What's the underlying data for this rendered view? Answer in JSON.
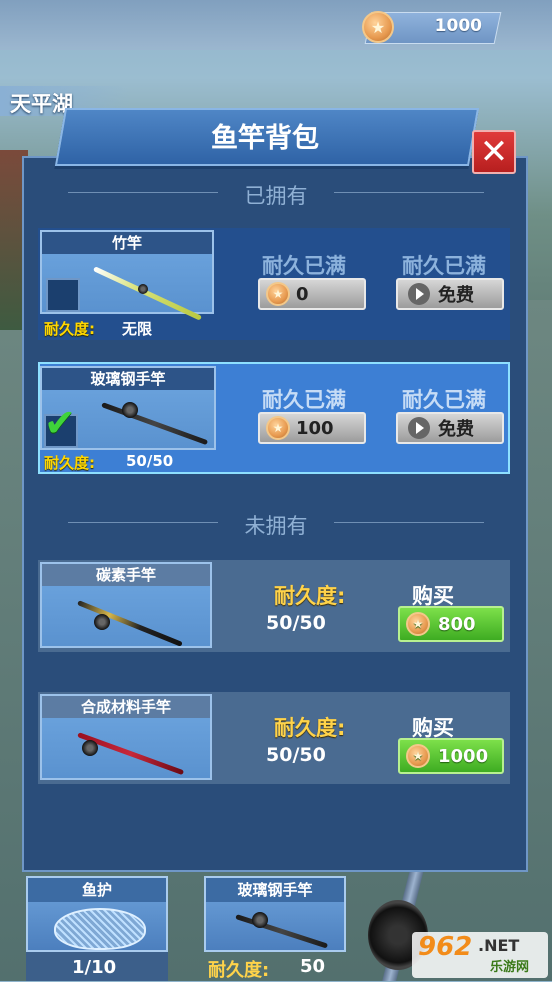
{
  "top_bar": {
    "coins": "1000"
  },
  "location": "天平湖",
  "panel": {
    "title": "鱼竿背包",
    "owned_heading": "已拥有",
    "unowned_heading": "未拥有"
  },
  "owned_rods": [
    {
      "name": "竹竿",
      "durability_label": "耐久度:",
      "durability_value": "无限",
      "repair_status": "耐久已满",
      "repair_coin_cost": "0",
      "free_status": "耐久已满",
      "free_label": "免费",
      "equipped": false
    },
    {
      "name": "玻璃钢手竿",
      "durability_label": "耐久度:",
      "durability_value": "50/50",
      "repair_status": "耐久已满",
      "repair_coin_cost": "100",
      "free_status": "耐久已满",
      "free_label": "免费",
      "equipped": true
    }
  ],
  "unowned_rods": [
    {
      "name": "碳素手竿",
      "durability_label": "耐久度:",
      "durability_value": "50/50",
      "buy_label": "购买",
      "price": "800"
    },
    {
      "name": "合成材料手竿",
      "durability_label": "耐久度:",
      "durability_value": "50/50",
      "buy_label": "购买",
      "price": "1000"
    }
  ],
  "bottom_slots": [
    {
      "title": "鱼护",
      "footer": "1/10"
    },
    {
      "title": "玻璃钢手竿",
      "footer_label": "耐久度:",
      "footer_value": "50"
    }
  ],
  "watermark": {
    "number": "962",
    "suffix": ".NET",
    "site": "乐游网"
  },
  "icons": {
    "coin": "coin-icon",
    "close": "close-icon",
    "play": "play-icon",
    "check": "check-icon",
    "net": "fish-net-icon"
  },
  "colors": {
    "panel": "#2a4d7a",
    "selected_card": "#3d7fd4",
    "buy_button": "#4fc02e",
    "close_button": "#d32f2f",
    "durability_label": "#ffd700"
  }
}
